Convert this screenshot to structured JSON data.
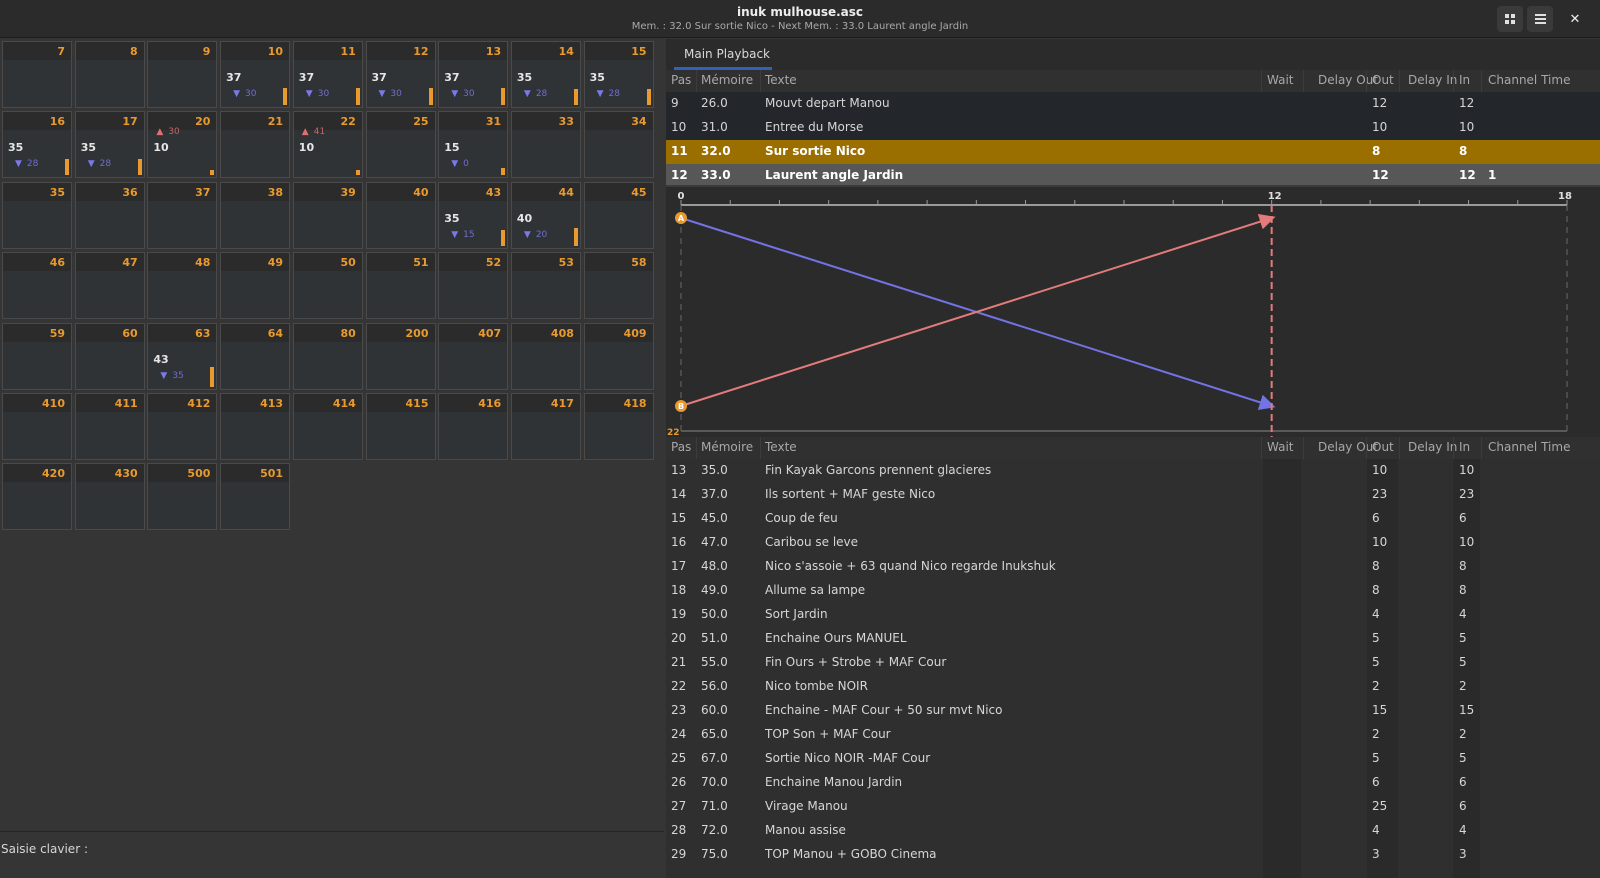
{
  "window": {
    "title": "inuk mulhouse.asc",
    "subtitle": "Mem. : 32.0 Sur sortie Nico - Next Mem. : 33.0 Laurent angle Jardin",
    "buttons": {
      "grid_icon": "grid-icon",
      "menu_icon": "hamburger-menu-icon",
      "close_label": "✕"
    }
  },
  "channels": [
    {
      "num": "7"
    },
    {
      "num": "8"
    },
    {
      "num": "9"
    },
    {
      "num": "10",
      "level": "37",
      "next": "30",
      "dir": "down",
      "bar": 0.37
    },
    {
      "num": "11",
      "level": "37",
      "next": "30",
      "dir": "down",
      "bar": 0.37
    },
    {
      "num": "12",
      "level": "37",
      "next": "30",
      "dir": "down",
      "bar": 0.37
    },
    {
      "num": "13",
      "level": "37",
      "next": "30",
      "dir": "down",
      "bar": 0.37
    },
    {
      "num": "14",
      "level": "35",
      "next": "28",
      "dir": "down",
      "bar": 0.35
    },
    {
      "num": "15",
      "level": "35",
      "next": "28",
      "dir": "down",
      "bar": 0.35
    },
    {
      "num": "16",
      "level": "35",
      "next": "28",
      "dir": "down",
      "bar": 0.35
    },
    {
      "num": "17",
      "level": "35",
      "next": "28",
      "dir": "down",
      "bar": 0.35
    },
    {
      "num": "20",
      "level": "10",
      "next": "30",
      "dir": "up",
      "bar": 0.1
    },
    {
      "num": "21"
    },
    {
      "num": "22",
      "level": "10",
      "next": "41",
      "dir": "up",
      "bar": 0.1
    },
    {
      "num": "25"
    },
    {
      "num": "31",
      "level": "15",
      "next": "0",
      "dir": "down",
      "bar": 0.15
    },
    {
      "num": "33"
    },
    {
      "num": "34"
    },
    {
      "num": "35"
    },
    {
      "num": "36"
    },
    {
      "num": "37"
    },
    {
      "num": "38"
    },
    {
      "num": "39"
    },
    {
      "num": "40"
    },
    {
      "num": "43",
      "level": "35",
      "next": "15",
      "dir": "down",
      "bar": 0.35
    },
    {
      "num": "44",
      "level": "40",
      "next": "20",
      "dir": "down",
      "bar": 0.4
    },
    {
      "num": "45"
    },
    {
      "num": "46"
    },
    {
      "num": "47"
    },
    {
      "num": "48"
    },
    {
      "num": "49"
    },
    {
      "num": "50"
    },
    {
      "num": "51"
    },
    {
      "num": "52"
    },
    {
      "num": "53"
    },
    {
      "num": "58"
    },
    {
      "num": "59"
    },
    {
      "num": "60"
    },
    {
      "num": "63",
      "level": "43",
      "next": "35",
      "dir": "down",
      "bar": 0.43
    },
    {
      "num": "64"
    },
    {
      "num": "80"
    },
    {
      "num": "200"
    },
    {
      "num": "407"
    },
    {
      "num": "408"
    },
    {
      "num": "409"
    },
    {
      "num": "410"
    },
    {
      "num": "411"
    },
    {
      "num": "412"
    },
    {
      "num": "413"
    },
    {
      "num": "414"
    },
    {
      "num": "415"
    },
    {
      "num": "416"
    },
    {
      "num": "417"
    },
    {
      "num": "418"
    },
    {
      "num": "420"
    },
    {
      "num": "430"
    },
    {
      "num": "500"
    },
    {
      "num": "501"
    }
  ],
  "keyboard_input": {
    "label": "Saisie clavier :"
  },
  "playback": {
    "tab_label": "Main Playback",
    "columns": [
      "Pas",
      "Mémoire",
      "Texte",
      "Wait",
      "Delay Out",
      "Out",
      "Delay In",
      "In",
      "Channel Time"
    ],
    "top_rows": [
      {
        "pas": "9",
        "mem": "26.0",
        "text": "Mouvt depart Manou",
        "wait": "",
        "dout": "",
        "out": "12",
        "din": "",
        "in": "12",
        "ct": "",
        "state": "top"
      },
      {
        "pas": "10",
        "mem": "31.0",
        "text": "Entree du Morse",
        "wait": "",
        "dout": "",
        "out": "10",
        "din": "",
        "in": "10",
        "ct": "",
        "state": "top"
      },
      {
        "pas": "11",
        "mem": "32.0",
        "text": "Sur sortie Nico",
        "wait": "",
        "dout": "",
        "out": "8",
        "din": "",
        "in": "8",
        "ct": "",
        "state": "active"
      },
      {
        "pas": "12",
        "mem": "33.0",
        "text": "Laurent angle Jardin",
        "wait": "",
        "dout": "",
        "out": "12",
        "din": "",
        "in": "12",
        "ct": "1",
        "state": "next"
      }
    ],
    "bottom_rows": [
      {
        "pas": "13",
        "mem": "35.0",
        "text": "Fin Kayak Garcons prennent glacieres",
        "out": "10",
        "in": "10"
      },
      {
        "pas": "14",
        "mem": "37.0",
        "text": "Ils sortent + MAF geste Nico",
        "out": "23",
        "in": "23"
      },
      {
        "pas": "15",
        "mem": "45.0",
        "text": "Coup de feu",
        "out": "6",
        "in": "6"
      },
      {
        "pas": "16",
        "mem": "47.0",
        "text": "Caribou se leve",
        "out": "10",
        "in": "10"
      },
      {
        "pas": "17",
        "mem": "48.0",
        "text": "Nico s'assoie + 63 quand Nico regarde Inukshuk",
        "out": "8",
        "in": "8"
      },
      {
        "pas": "18",
        "mem": "49.0",
        "text": "Allume sa lampe",
        "out": "8",
        "in": "8"
      },
      {
        "pas": "19",
        "mem": "50.0",
        "text": "Sort Jardin",
        "out": "4",
        "in": "4"
      },
      {
        "pas": "20",
        "mem": "51.0",
        "text": "Enchaine Ours MANUEL",
        "out": "5",
        "in": "5"
      },
      {
        "pas": "21",
        "mem": "55.0",
        "text": "Fin Ours + Strobe + MAF Cour",
        "out": "5",
        "in": "5"
      },
      {
        "pas": "22",
        "mem": "56.0",
        "text": "Nico tombe NOIR",
        "out": "2",
        "in": "2"
      },
      {
        "pas": "23",
        "mem": "60.0",
        "text": "Enchaine - MAF Cour + 50 sur mvt Nico",
        "out": "15",
        "in": "15"
      },
      {
        "pas": "24",
        "mem": "65.0",
        "text": "TOP Son + MAF Cour",
        "out": "2",
        "in": "2"
      },
      {
        "pas": "25",
        "mem": "67.0",
        "text": "Sortie Nico NOIR -MAF Cour",
        "out": "5",
        "in": "5"
      },
      {
        "pas": "26",
        "mem": "70.0",
        "text": "Enchaine Manou Jardin",
        "out": "6",
        "in": "6"
      },
      {
        "pas": "27",
        "mem": "71.0",
        "text": "Virage Manou",
        "out": "25",
        "in": "6"
      },
      {
        "pas": "28",
        "mem": "72.0",
        "text": "Manou assise",
        "out": "4",
        "in": "4"
      },
      {
        "pas": "29",
        "mem": "75.0",
        "text": "TOP Manou + GOBO Cinema",
        "out": "3",
        "in": "3"
      }
    ],
    "crossfade": {
      "scale_start": "0",
      "scale_mark": "12",
      "scale_end": "18",
      "scale_max": 18,
      "marker_time": 12,
      "fader_a_label": "A",
      "fader_b_label": "B",
      "fader_a_duration": 12,
      "fader_b_duration": 12,
      "level_label": "22",
      "colors": {
        "out_line": "#7373e6",
        "in_line": "#e37b7b",
        "marker": "#e89a2f",
        "accent": "#e89a2f"
      }
    }
  }
}
